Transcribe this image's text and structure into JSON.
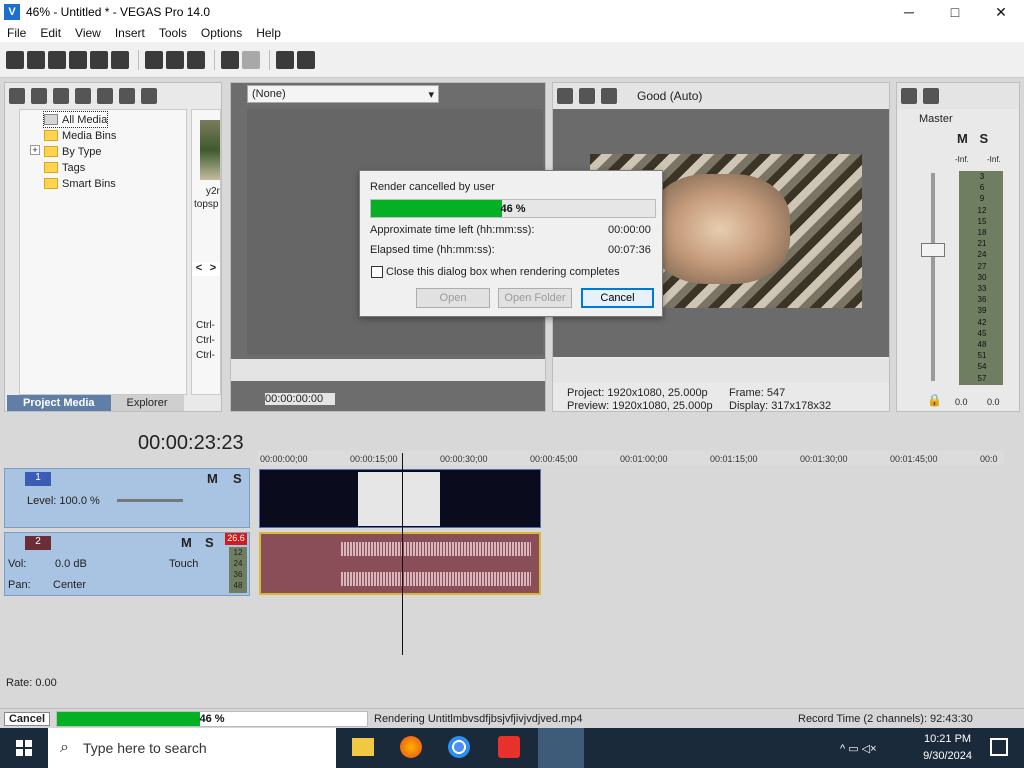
{
  "window": {
    "title": "46% - Untitled * - VEGAS Pro 14.0",
    "app_icon_letter": "V"
  },
  "window_controls": {
    "minimize": "─",
    "maximize": "□",
    "close": "✕"
  },
  "menu": [
    "File",
    "Edit",
    "View",
    "Insert",
    "Tools",
    "Options",
    "Help"
  ],
  "media": {
    "tree": [
      "All Media",
      "Media Bins",
      "By Type",
      "Tags",
      "Smart Bins"
    ],
    "expander": "+",
    "thumbnail_label_1": "y2r",
    "thumbnail_label_2": "topsp",
    "nav_prev": "<",
    "nav_next": ">",
    "ctrl_labels": [
      "Ctrl-",
      "Ctrl-",
      "Ctrl-"
    ],
    "tabs": [
      "Project Media",
      "Explorer"
    ]
  },
  "trimmer": {
    "dropdown_value": "(None)",
    "timecode": "00:00:00:00"
  },
  "preview": {
    "quality": "Good (Auto)",
    "project_label": "Project:",
    "project_value": "1920x1080, 25.000p",
    "preview_label": "Preview:",
    "preview_value": "1920x1080, 25.000p",
    "frame_label": "Frame:",
    "frame_value": "547",
    "display_label": "Display:",
    "display_value": "317x178x32"
  },
  "master": {
    "title": "Master",
    "m": "M",
    "s": "S",
    "inf_left": "-Inf.",
    "inf_right": "-Inf.",
    "scale": [
      "3",
      "6",
      "9",
      "12",
      "15",
      "18",
      "21",
      "24",
      "27",
      "30",
      "33",
      "36",
      "39",
      "42",
      "45",
      "48",
      "51",
      "54",
      "57"
    ],
    "bottom_left": "0.0",
    "bottom_right": "0.0"
  },
  "dialog": {
    "title": "Render cancelled by user",
    "progress_percent": 46,
    "progress_label": "46 %",
    "time_left_label": "Approximate time left (hh:mm:ss):",
    "time_left_value": "00:00:00",
    "elapsed_label": "Elapsed time (hh:mm:ss):",
    "elapsed_value": "00:07:36",
    "checkbox_label": "Close this dialog box when rendering completes",
    "open_label": "Open",
    "open_folder_label": "Open Folder",
    "cancel_label": "Cancel"
  },
  "timeline": {
    "timecode": "00:00:23:23",
    "ruler": [
      "00:00:00;00",
      "00:00:15;00",
      "00:00:30;00",
      "00:00:45;00",
      "00:01:00;00",
      "00:01:15;00",
      "00:01:30;00",
      "00:01:45;00",
      "00:0"
    ],
    "video_track": {
      "number": "1",
      "level_label": "Level: 100.0 %",
      "m": "M",
      "s": "S"
    },
    "audio_track": {
      "number": "2",
      "vol_label": "Vol:",
      "vol_value": "0.0 dB",
      "pan_label": "Pan:",
      "pan_value": "Center",
      "touch": "Touch",
      "m": "M",
      "s": "S",
      "peak": "26.6",
      "meter_scale": [
        "12",
        "24",
        "36",
        "48"
      ]
    }
  },
  "transport": {
    "rate": "Rate: 0.00"
  },
  "status": {
    "cancel_label": "Cancel",
    "progress_percent": 46,
    "progress_label": "46 %",
    "rendering_text": "Rendering Untitlmbvsdfjbsjvfjivjvdjved.mp4",
    "record_time": "Record Time (2 channels): 92:43:30"
  },
  "taskbar": {
    "search_placeholder": "Type here to search",
    "time": "10:21 PM",
    "date": "9/30/2024"
  },
  "colors": {
    "progress_green": "#06b025",
    "audio_clip": "#8a4e59",
    "track_header": "#a9c3e2",
    "taskbar": "#1b2a3a",
    "focus_blue": "#0078d7"
  }
}
